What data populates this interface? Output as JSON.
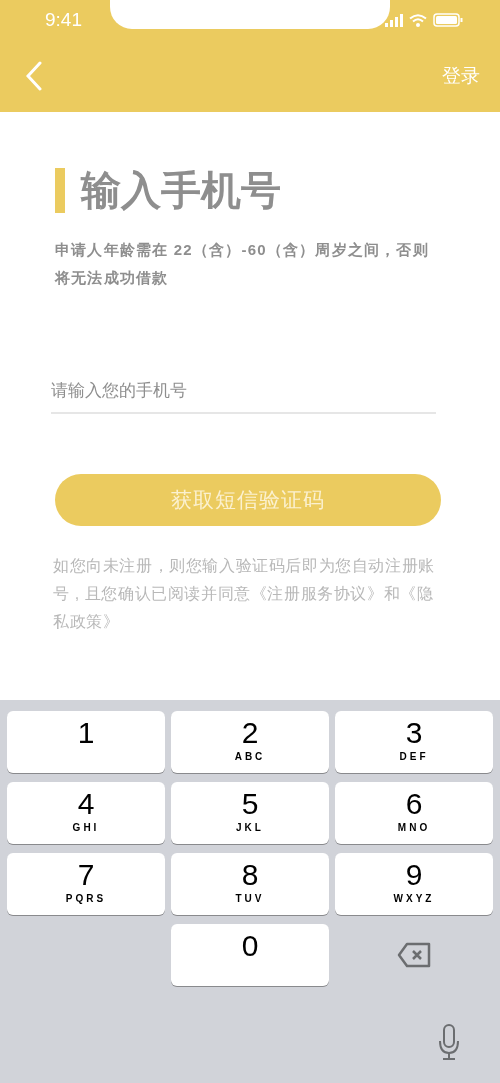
{
  "status_bar": {
    "time": "9:41"
  },
  "nav": {
    "action": "登录"
  },
  "heading": "输入手机号",
  "notice": "申请人年龄需在 22（含）-60（含）周岁之间，否则将无法成功借款",
  "phone_field": {
    "placeholder": "请输入您的手机号"
  },
  "submit_button": {
    "label": "获取短信验证码",
    "disabled": true
  },
  "agreement": "如您向未注册，则您输入验证码后即为您自动注册账号 , 且您确认已阅读并同意《注册服务协议》和《隐私政策》",
  "keypad": [
    {
      "kind": "digit",
      "digit": "1"
    },
    {
      "kind": "digit",
      "digit": "2",
      "letters": "ABC"
    },
    {
      "kind": "digit",
      "digit": "3",
      "letters": "DEF"
    },
    {
      "kind": "digit",
      "digit": "4",
      "letters": "GHI"
    },
    {
      "kind": "digit",
      "digit": "5",
      "letters": "JKL"
    },
    {
      "kind": "digit",
      "digit": "6",
      "letters": "MNO"
    },
    {
      "kind": "digit",
      "digit": "7",
      "letters": "PQRS"
    },
    {
      "kind": "digit",
      "digit": "8",
      "letters": "TUV"
    },
    {
      "kind": "digit",
      "digit": "9",
      "letters": "WXYZ"
    },
    {
      "kind": "blank"
    },
    {
      "kind": "digit",
      "digit": "0"
    },
    {
      "kind": "delete"
    }
  ]
}
